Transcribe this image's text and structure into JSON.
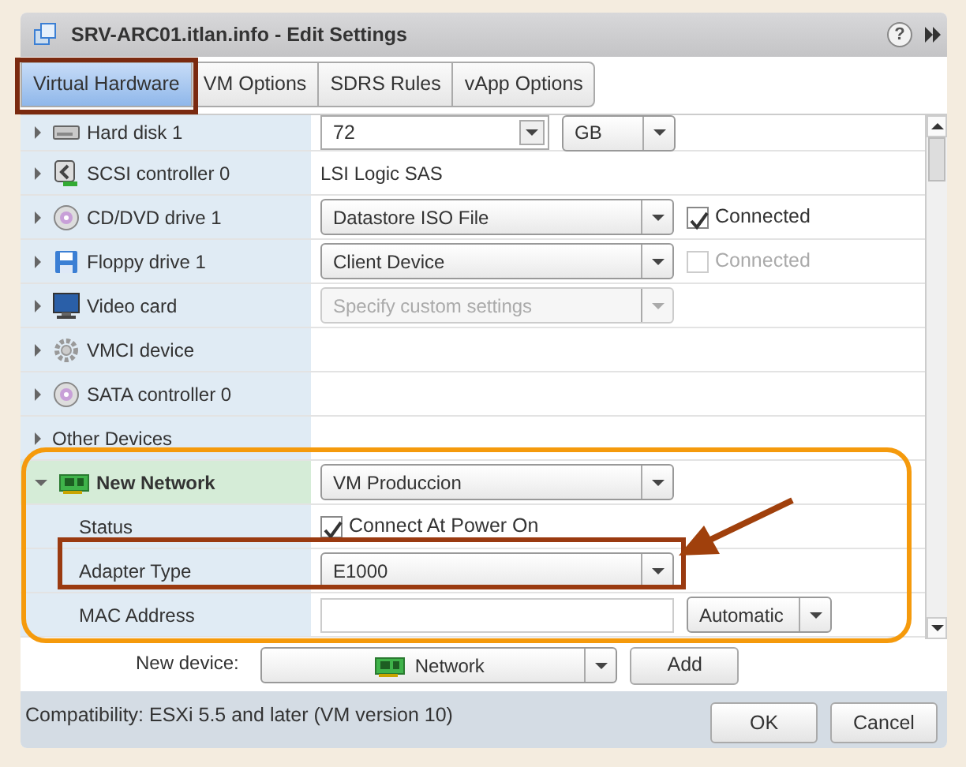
{
  "window": {
    "title": "SRV-ARC01.itlan.info - Edit Settings",
    "help": "?"
  },
  "tabs": [
    {
      "label": "Virtual Hardware",
      "selected": true
    },
    {
      "label": "VM Options",
      "selected": false
    },
    {
      "label": "SDRS Rules",
      "selected": false
    },
    {
      "label": "vApp Options",
      "selected": false
    }
  ],
  "devices": [
    {
      "label": "Hard disk 1",
      "expanded": false,
      "highlighted": false,
      "kind": "spin",
      "value": "72",
      "unit": "GB"
    },
    {
      "label": "SCSI controller 0",
      "expanded": false,
      "highlighted": false,
      "kind": "text",
      "value": "LSI Logic SAS"
    },
    {
      "label": "CD/DVD drive 1",
      "expanded": false,
      "highlighted": false,
      "kind": "select",
      "value": "Datastore ISO File",
      "disabled": false,
      "check": {
        "label": "Connected",
        "checked": true,
        "disabled": false
      }
    },
    {
      "label": "Floppy drive 1",
      "expanded": false,
      "highlighted": false,
      "kind": "select",
      "value": "Client Device",
      "disabled": false,
      "check": {
        "label": "Connected",
        "checked": false,
        "disabled": true
      }
    },
    {
      "label": "Video card",
      "expanded": false,
      "highlighted": false,
      "kind": "select",
      "value": "Specify custom settings",
      "disabled": true
    },
    {
      "label": "VMCI device",
      "expanded": false,
      "highlighted": false,
      "kind": "none"
    },
    {
      "label": "SATA controller 0",
      "expanded": false,
      "highlighted": false,
      "kind": "none"
    },
    {
      "label": "Other Devices",
      "expanded": false,
      "highlighted": false,
      "kind": "none"
    },
    {
      "label": "New Network",
      "expanded": true,
      "highlighted": true,
      "kind": "select",
      "value": "VM Produccion",
      "disabled": false,
      "children": [
        {
          "label": "Status",
          "kind": "check",
          "check": {
            "label": "Connect At Power On",
            "checked": true,
            "disabled": false
          }
        },
        {
          "label": "Adapter Type",
          "kind": "select",
          "value": "E1000",
          "disabled": false
        },
        {
          "label": "MAC Address",
          "kind": "input-select",
          "value": "Automatic"
        }
      ]
    }
  ],
  "new_device": {
    "label": "New device:",
    "value": "Network",
    "button": "Add"
  },
  "footer": {
    "compatibility": "Compatibility: ESXi 5.5 and later (VM version 10)",
    "buttons": [
      "OK",
      "Cancel"
    ]
  }
}
